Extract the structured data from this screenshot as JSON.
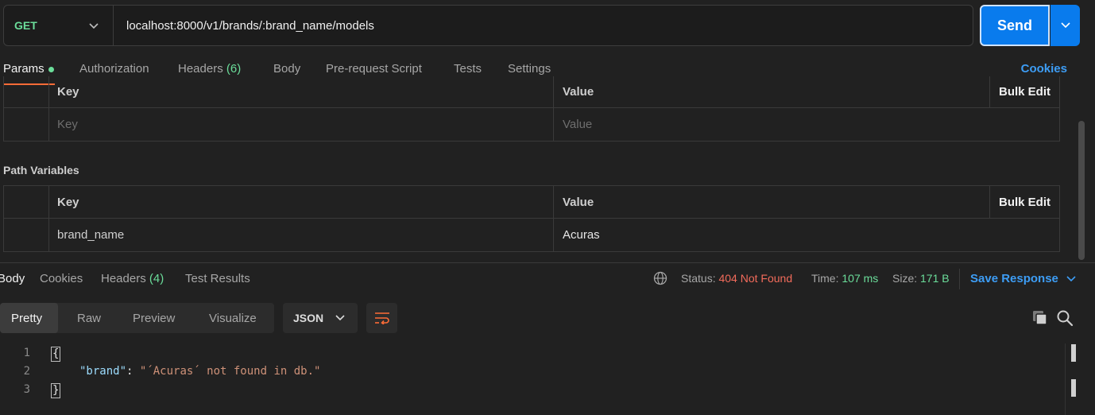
{
  "request": {
    "method": "GET",
    "url": "localhost:8000/v1/brands/:brand_name/models",
    "send_label": "Send"
  },
  "request_tabs": {
    "params": "Params",
    "authorization": "Authorization",
    "headers": "Headers",
    "headers_count": "(6)",
    "body": "Body",
    "prerequest": "Pre-request Script",
    "tests": "Tests",
    "settings": "Settings",
    "cookies": "Cookies"
  },
  "query_params": {
    "col_key": "Key",
    "col_value": "Value",
    "bulk_edit": "Bulk Edit",
    "key_placeholder": "Key",
    "value_placeholder": "Value"
  },
  "path_variables": {
    "title": "Path Variables",
    "col_key": "Key",
    "col_value": "Value",
    "bulk_edit": "Bulk Edit",
    "rows": [
      {
        "key": "brand_name",
        "value": "Acuras"
      }
    ]
  },
  "response_tabs": {
    "body": "Body",
    "cookies": "Cookies",
    "headers": "Headers",
    "headers_count": "(4)",
    "test_results": "Test Results"
  },
  "response_status": {
    "status_label": "Status:",
    "status_value": "404 Not Found",
    "time_label": "Time:",
    "time_value": "107 ms",
    "size_label": "Size:",
    "size_value": "171 B",
    "save_response": "Save Response"
  },
  "view": {
    "pretty": "Pretty",
    "raw": "Raw",
    "preview": "Preview",
    "visualize": "Visualize",
    "format": "JSON"
  },
  "response_body": {
    "lines": [
      {
        "n": "1",
        "open": "{"
      },
      {
        "n": "2",
        "key": "\"brand\"",
        "sep": ": ",
        "value": "\"´Acuras´ not found in db.\""
      },
      {
        "n": "3",
        "close": "}"
      }
    ]
  },
  "colors": {
    "accent_blue": "#097bed",
    "tab_underline": "#ff6c37",
    "green": "#6bdd9a",
    "error_red": "#f26b5b",
    "link_blue": "#3d9df5"
  }
}
